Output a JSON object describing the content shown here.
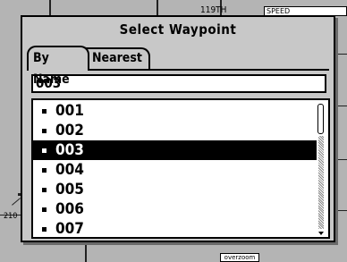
{
  "map": {
    "street_label": "119TH",
    "speed_label": "SPEED",
    "scale_label": "210",
    "zoom_label": "overzoom"
  },
  "dialog": {
    "title": "Select Waypoint",
    "tabs": [
      {
        "label": "By Name",
        "active": true
      },
      {
        "label": "Nearest",
        "active": false
      }
    ],
    "search_value": "003",
    "items": [
      {
        "label": "001",
        "selected": false
      },
      {
        "label": "002",
        "selected": false
      },
      {
        "label": "003",
        "selected": true
      },
      {
        "label": "004",
        "selected": false
      },
      {
        "label": "005",
        "selected": false
      },
      {
        "label": "006",
        "selected": false
      },
      {
        "label": "007",
        "selected": false
      }
    ]
  }
}
